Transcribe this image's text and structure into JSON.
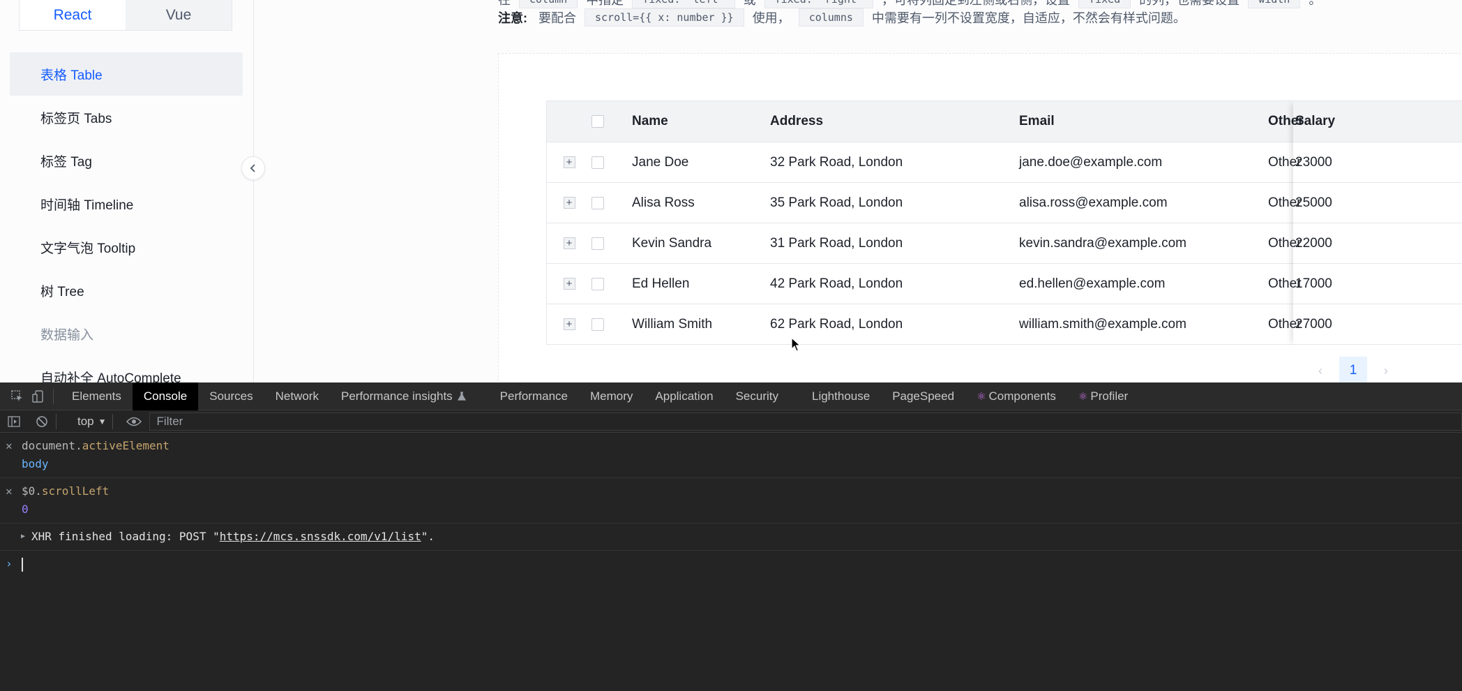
{
  "framework_switch": {
    "react": "React",
    "vue": "Vue"
  },
  "sidebar": {
    "items": [
      {
        "label": "表格 Table",
        "active": true
      },
      {
        "label": "标签页 Tabs"
      },
      {
        "label": "标签 Tag"
      },
      {
        "label": "时间轴 Timeline"
      },
      {
        "label": "文字气泡 Tooltip"
      },
      {
        "label": "树 Tree"
      },
      {
        "label": "数据输入",
        "group": true
      },
      {
        "label": "自动补全 AutoComplete"
      }
    ]
  },
  "description": {
    "line1": {
      "prefix": "在",
      "code1": "column",
      "t1": "中指定",
      "code2": "fixed: 'left'",
      "t2": "或",
      "code3": "fixed: 'right'",
      "t3": "，可将列固定到左侧或右侧，设置",
      "code4": "fixed",
      "t4": "的列，也需要设置",
      "code5": "width",
      "t5": "。"
    },
    "line2": {
      "label": "注意:",
      "t1": "要配合",
      "code1": "scroll={{ x: number }}",
      "t2": "使用，",
      "code2": "columns",
      "t3": "中需要有一列不设置宽度，自适应，不然会有样式问题。"
    }
  },
  "table": {
    "columns": {
      "name": "Name",
      "address": "Address",
      "email": "Email",
      "other": "Other",
      "salary": "Salary"
    },
    "rows": [
      {
        "name": "Jane Doe",
        "address": "32 Park Road, London",
        "email": "jane.doe@example.com",
        "other": "Other",
        "salary": "23000"
      },
      {
        "name": "Alisa Ross",
        "address": "35 Park Road, London",
        "email": "alisa.ross@example.com",
        "other": "Other",
        "salary": "25000"
      },
      {
        "name": "Kevin Sandra",
        "address": "31 Park Road, London",
        "email": "kevin.sandra@example.com",
        "other": "Other",
        "salary": "22000"
      },
      {
        "name": "Ed Hellen",
        "address": "42 Park Road, London",
        "email": "ed.hellen@example.com",
        "other": "Other",
        "salary": "17000"
      },
      {
        "name": "William Smith",
        "address": "62 Park Road, London",
        "email": "william.smith@example.com",
        "other": "Other",
        "salary": "27000"
      }
    ]
  },
  "pagination": {
    "prev": "‹",
    "current": "1",
    "next": "›"
  },
  "devtools": {
    "tabs": [
      "Elements",
      "Console",
      "Sources",
      "Network",
      "Performance insights",
      "Performance",
      "Memory",
      "Application",
      "Security",
      "Lighthouse",
      "PageSpeed",
      "Components",
      "Profiler"
    ],
    "active_tab": "Console",
    "context": "top",
    "filter_placeholder": "Filter",
    "console": {
      "entry1": {
        "object": "document.",
        "property": "activeElement",
        "result": "body"
      },
      "entry2": {
        "object": "$0.",
        "property": "scrollLeft",
        "result": "0"
      },
      "xhr": {
        "prefix": "XHR finished loading: POST \"",
        "url": "https://mcs.snssdk.com/v1/list",
        "suffix": "\"."
      }
    }
  },
  "colors": {
    "accent": "#165dff",
    "devtools_bg": "#242424"
  }
}
